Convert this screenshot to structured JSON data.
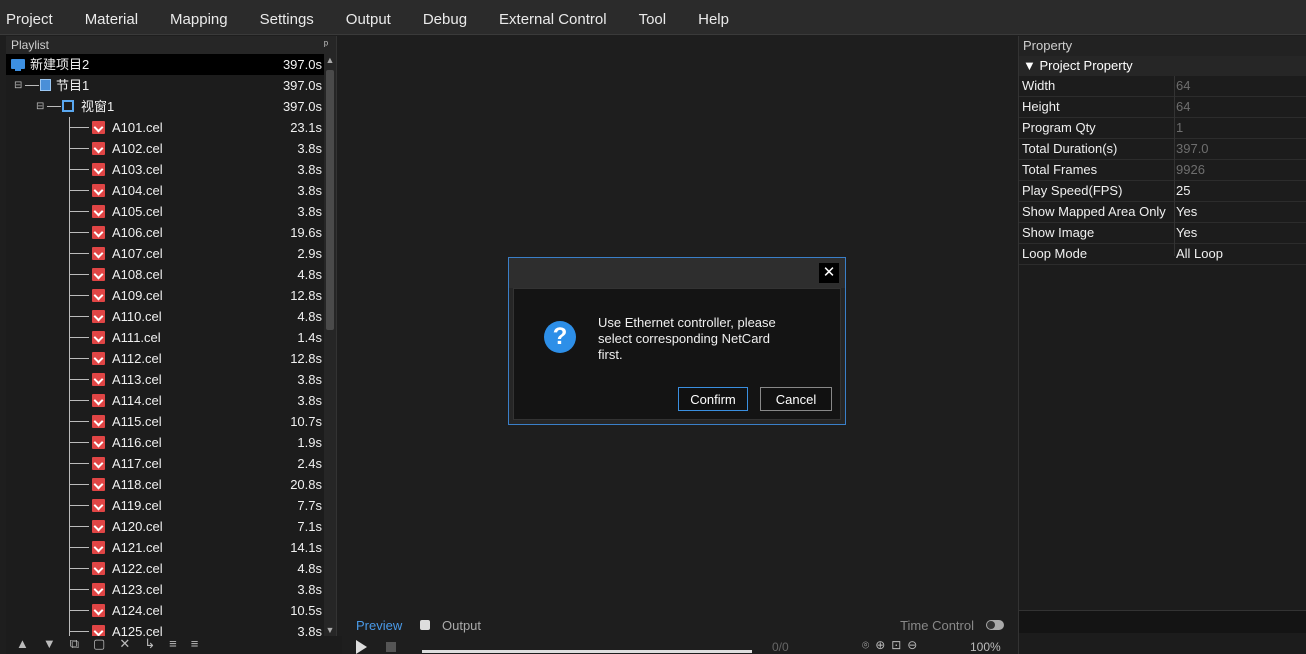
{
  "menu": [
    "Project",
    "Material",
    "Mapping",
    "Settings",
    "Output",
    "Debug",
    "External Control",
    "Tool",
    "Help"
  ],
  "playlist": {
    "title": "Playlist",
    "pin_glyph": "ᵖ",
    "project": {
      "name": "新建项目2",
      "duration": "397.0s"
    },
    "program": {
      "name": "节目1",
      "duration": "397.0s"
    },
    "window": {
      "name": "视窗1",
      "duration": "397.0s"
    },
    "files": [
      {
        "name": "A101.cel",
        "duration": "23.1s"
      },
      {
        "name": "A102.cel",
        "duration": "3.8s"
      },
      {
        "name": "A103.cel",
        "duration": "3.8s"
      },
      {
        "name": "A104.cel",
        "duration": "3.8s"
      },
      {
        "name": "A105.cel",
        "duration": "3.8s"
      },
      {
        "name": "A106.cel",
        "duration": "19.6s"
      },
      {
        "name": "A107.cel",
        "duration": "2.9s"
      },
      {
        "name": "A108.cel",
        "duration": "4.8s"
      },
      {
        "name": "A109.cel",
        "duration": "12.8s"
      },
      {
        "name": "A110.cel",
        "duration": "4.8s"
      },
      {
        "name": "A111.cel",
        "duration": "1.4s"
      },
      {
        "name": "A112.cel",
        "duration": "12.8s"
      },
      {
        "name": "A113.cel",
        "duration": "3.8s"
      },
      {
        "name": "A114.cel",
        "duration": "3.8s"
      },
      {
        "name": "A115.cel",
        "duration": "10.7s"
      },
      {
        "name": "A116.cel",
        "duration": "1.9s"
      },
      {
        "name": "A117.cel",
        "duration": "2.4s"
      },
      {
        "name": "A118.cel",
        "duration": "20.8s"
      },
      {
        "name": "A119.cel",
        "duration": "7.7s"
      },
      {
        "name": "A120.cel",
        "duration": "7.1s"
      },
      {
        "name": "A121.cel",
        "duration": "14.1s"
      },
      {
        "name": "A122.cel",
        "duration": "4.8s"
      },
      {
        "name": "A123.cel",
        "duration": "3.8s"
      },
      {
        "name": "A124.cel",
        "duration": "10.5s"
      },
      {
        "name": "A125.cel",
        "duration": "3.8s"
      }
    ],
    "toolbar_glyphs": [
      "▲",
      "▼",
      "⧉",
      "▢",
      "✕",
      "↳",
      "≡",
      "≡"
    ]
  },
  "preview": {
    "tab_preview": "Preview",
    "tab_output": "Output",
    "time_control": "Time Control",
    "frame_count": "0/0",
    "zoom_glyphs": "⌾⊕⊡⊖",
    "zoom_level": "100%",
    "progress_fraction": 0
  },
  "property": {
    "title": "Property",
    "section": "▼ Project Property",
    "rows": [
      {
        "key": "Width",
        "value": "64",
        "editable": false
      },
      {
        "key": "Height",
        "value": "64",
        "editable": false
      },
      {
        "key": "Program Qty",
        "value": "1",
        "editable": false
      },
      {
        "key": "Total Duration(s)",
        "value": "397.0",
        "editable": false
      },
      {
        "key": "Total Frames",
        "value": "9926",
        "editable": false
      },
      {
        "key": "Play Speed(FPS)",
        "value": "25",
        "editable": true
      },
      {
        "key": "Show Mapped Area Only",
        "value": "Yes",
        "editable": true
      },
      {
        "key": "Show Image",
        "value": "Yes",
        "editable": true
      },
      {
        "key": "Loop Mode",
        "value": "All Loop",
        "editable": true
      }
    ]
  },
  "dialog": {
    "close_glyph": "✕",
    "icon_glyph": "?",
    "message": "Use Ethernet controller, please select corresponding NetCard first.",
    "confirm": "Confirm",
    "cancel": "Cancel"
  }
}
